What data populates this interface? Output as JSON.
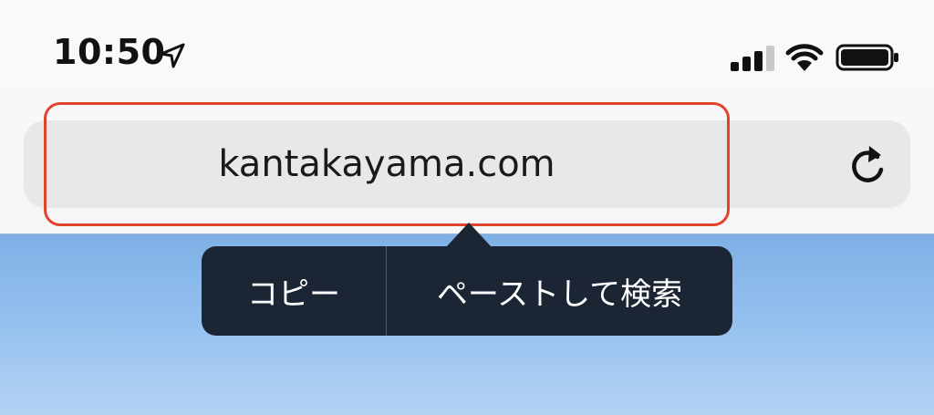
{
  "status_bar": {
    "time": "10:50",
    "icons": [
      "location-arrow-icon",
      "cellular-signal-icon",
      "wifi-icon",
      "battery-icon"
    ]
  },
  "address_bar": {
    "url": "kantakayama.com",
    "reload_icon": "reload-icon",
    "highlight_color": "#e0452b"
  },
  "context_menu": {
    "items": [
      {
        "label": "コピー"
      },
      {
        "label": "ペーストして検索"
      }
    ],
    "background": "#1b2533"
  }
}
